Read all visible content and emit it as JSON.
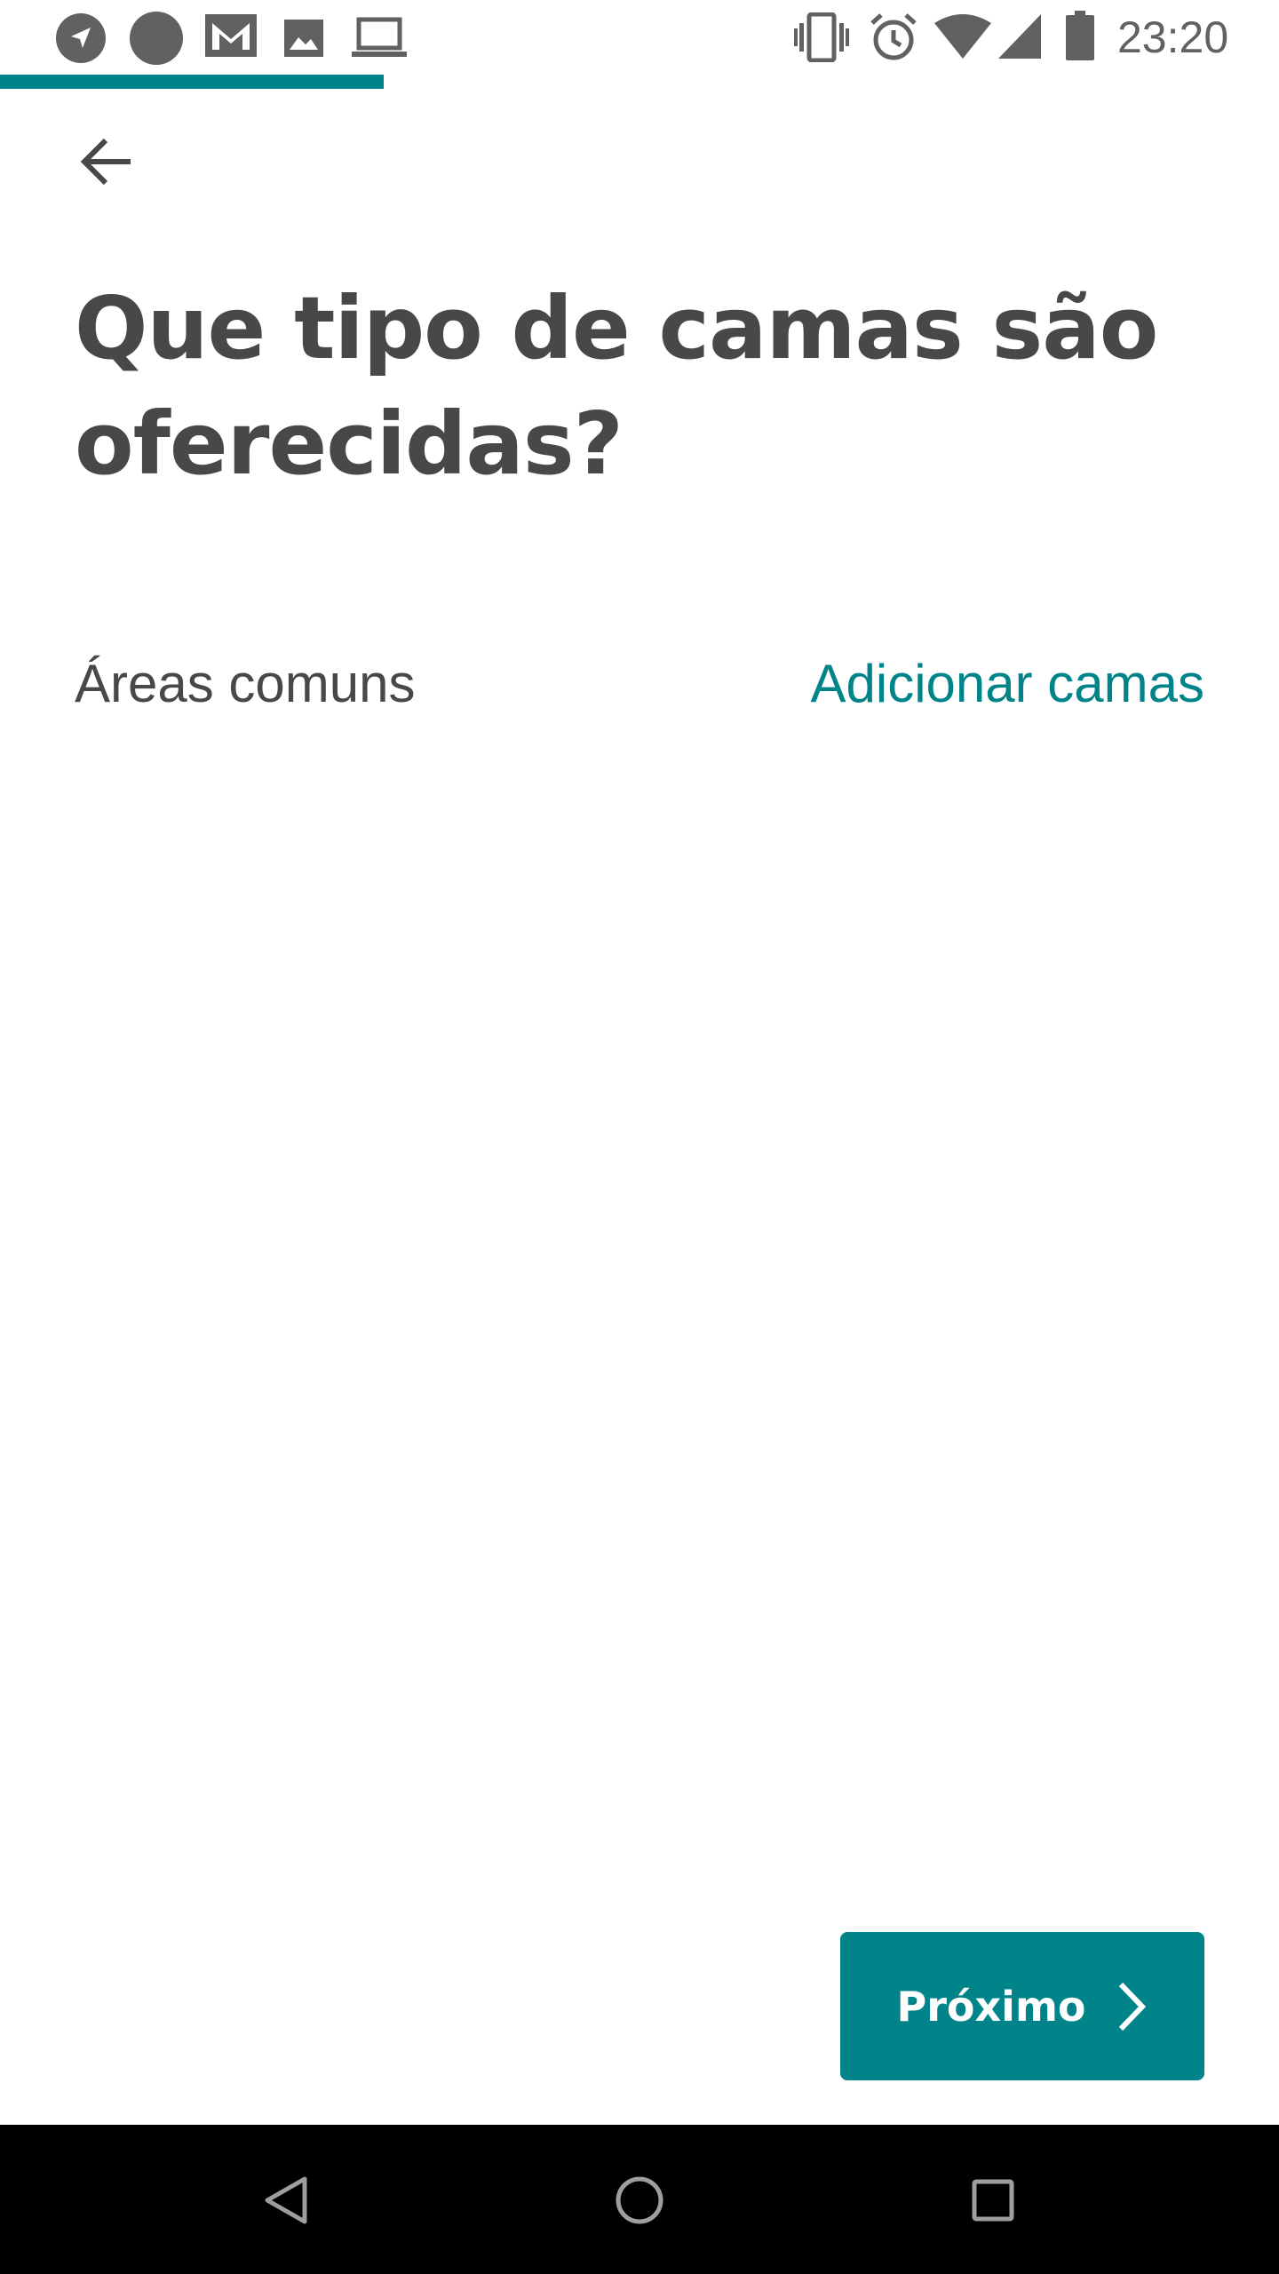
{
  "status_bar": {
    "time": "23:20",
    "left_icons": [
      "navigation-icon",
      "dot-icon",
      "gmail-icon",
      "image-icon",
      "laptop-icon"
    ],
    "right_icons": [
      "vibrate-icon",
      "alarm-icon",
      "wifi-icon",
      "signal-icon",
      "battery-icon"
    ],
    "icon_color": "#616161"
  },
  "progress": {
    "percent": 30,
    "color": "#008489"
  },
  "header": {
    "back_icon": "arrow-left-icon"
  },
  "main": {
    "title": "Que tipo de camas são oferecidas?",
    "section": {
      "label": "Áreas comuns",
      "action_label": "Adicionar camas"
    }
  },
  "footer": {
    "next_label": "Próximo",
    "next_icon": "chevron-right-icon",
    "accent_color": "#008489"
  },
  "nav_bar": {
    "buttons": [
      "back-triangle-icon",
      "home-circle-icon",
      "recents-square-icon"
    ]
  }
}
